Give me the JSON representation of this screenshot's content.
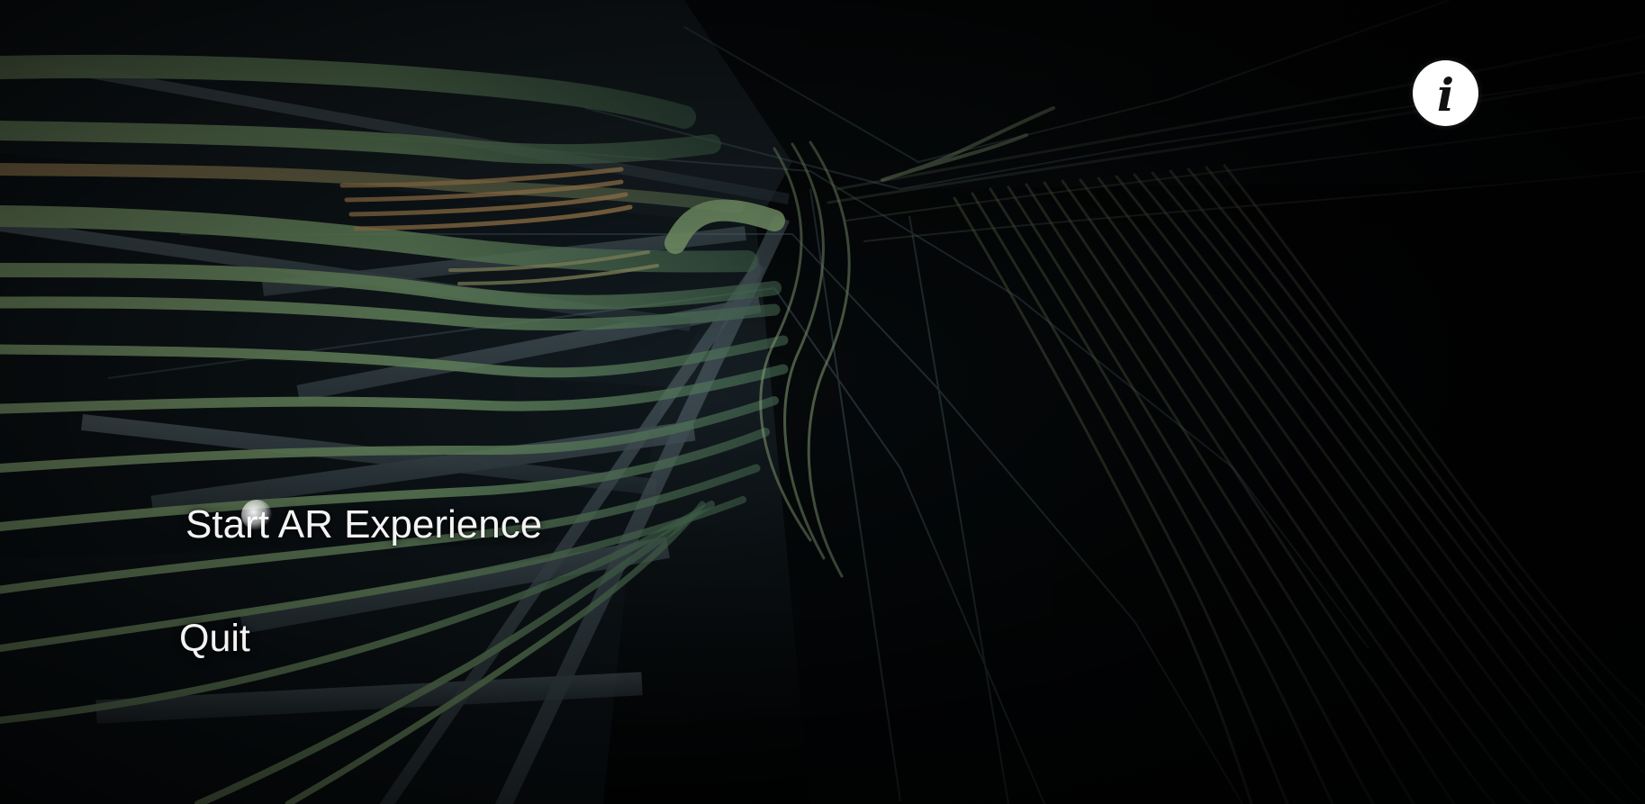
{
  "menu": {
    "start_label": "Start AR Experience",
    "quit_label": "Quit"
  },
  "info_button": {
    "icon": "info-icon",
    "glyph": "i"
  },
  "colors": {
    "background": "#000000",
    "menu_text": "#f3f3f3",
    "info_button_bg": "#ffffff",
    "info_button_glyph": "#111111"
  }
}
